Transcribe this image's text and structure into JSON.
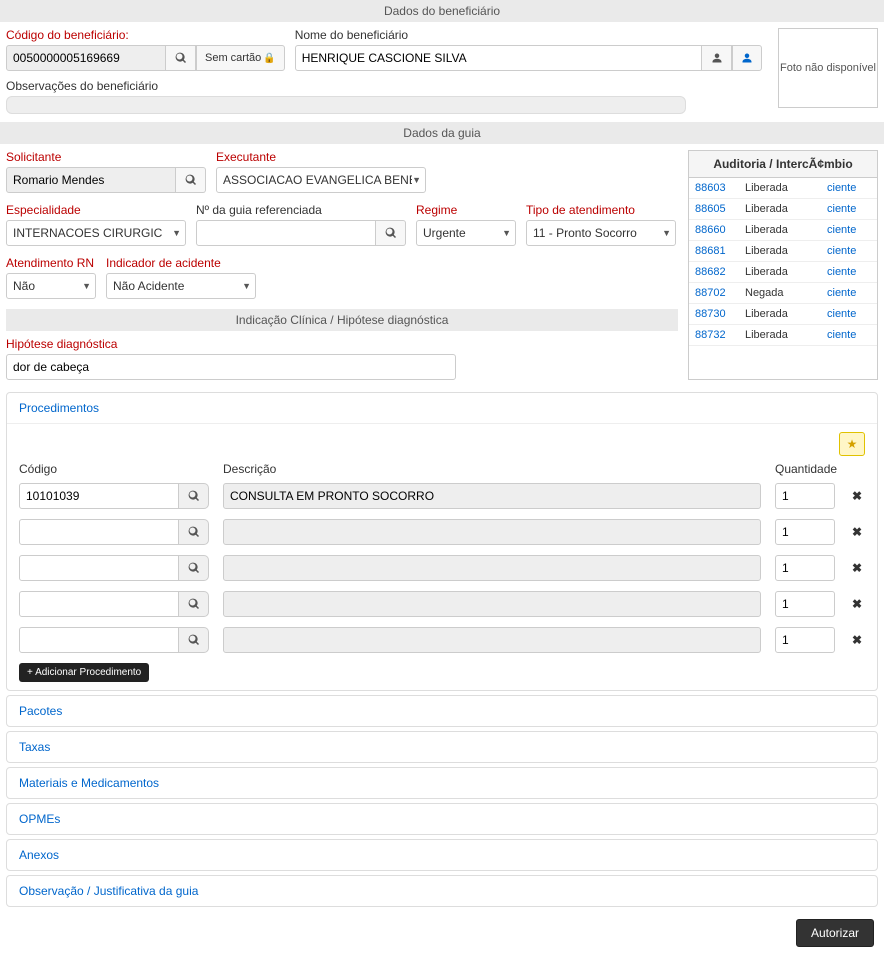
{
  "sections": {
    "beneficiario_header": "Dados do beneficiário",
    "guia_header": "Dados da guia",
    "hipotese_header": "Indicação Clínica / Hipótese diagnóstica"
  },
  "beneficiario": {
    "codigo_label": "Código do beneficiário:",
    "codigo_value": "0050000005169669",
    "sem_cartao_label": "Sem cartão",
    "nome_label": "Nome do beneficiário",
    "nome_value": "HENRIQUE CASCIONE SILVA",
    "obs_label": "Observações do beneficiário",
    "foto_label": "Foto não disponível"
  },
  "guia": {
    "solicitante_label": "Solicitante",
    "solicitante_value": "Romario Mendes",
    "executante_label": "Executante",
    "executante_value": "ASSOCIACAO EVANGELICA BENEFI",
    "especialidade_label": "Especialidade",
    "especialidade_value": "INTERNACOES CIRURGIC",
    "num_guia_label": "Nº da guia referenciada",
    "num_guia_value": "",
    "regime_label": "Regime",
    "regime_value": "Urgente",
    "tipo_atend_label": "Tipo de atendimento",
    "tipo_atend_value": "11 - Pronto Socorro",
    "atend_rn_label": "Atendimento RN",
    "atend_rn_value": "Não",
    "indicador_label": "Indicador de acidente",
    "indicador_value": "Não Acidente"
  },
  "hipotese": {
    "label": "Hipótese diagnóstica",
    "value": "dor de cabeça"
  },
  "audit": {
    "header": "Auditoria / IntercÃ¢mbio",
    "action": "ciente",
    "rows": [
      {
        "id": "88603",
        "status": "Liberada"
      },
      {
        "id": "88605",
        "status": "Liberada"
      },
      {
        "id": "88660",
        "status": "Liberada"
      },
      {
        "id": "88681",
        "status": "Liberada"
      },
      {
        "id": "88682",
        "status": "Liberada"
      },
      {
        "id": "88702",
        "status": "Negada"
      },
      {
        "id": "88730",
        "status": "Liberada"
      },
      {
        "id": "88732",
        "status": "Liberada"
      }
    ]
  },
  "procedimentos": {
    "tab_label": "Procedimentos",
    "codigo_header": "Código",
    "descricao_header": "Descrição",
    "quantidade_header": "Quantidade",
    "add_button": "+ Adicionar Procedimento",
    "rows": [
      {
        "codigo": "10101039",
        "descricao": "CONSULTA EM PRONTO SOCORRO",
        "qtd": "1",
        "highlight": true
      },
      {
        "codigo": "",
        "descricao": "",
        "qtd": "1",
        "highlight": false
      },
      {
        "codigo": "",
        "descricao": "",
        "qtd": "1",
        "highlight": false
      },
      {
        "codigo": "",
        "descricao": "",
        "qtd": "1",
        "highlight": false
      },
      {
        "codigo": "",
        "descricao": "",
        "qtd": "1",
        "highlight": false
      }
    ]
  },
  "tabs": {
    "pacotes": "Pacotes",
    "taxas": "Taxas",
    "materiais": "Materiais e Medicamentos",
    "opmes": "OPMEs",
    "anexos": "Anexos",
    "observacao": "Observação / Justificativa da guia"
  },
  "buttons": {
    "autorizar": "Autorizar"
  }
}
